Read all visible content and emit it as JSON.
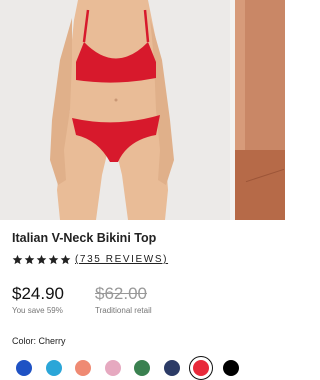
{
  "product": {
    "title": "Italian V-Neck Bikini Top",
    "rating_stars": 5,
    "reviews_text": "(735 REVIEWS)",
    "price": "$24.90",
    "savings": "You save 59%",
    "compare_price": "$62.00",
    "compare_label": "Traditional retail",
    "color_label": "Color: Cherry"
  },
  "swatches": [
    {
      "name": "blue",
      "color": "#1f52c4"
    },
    {
      "name": "turquoise",
      "color": "#2ba6d8"
    },
    {
      "name": "coral",
      "color": "#ef8a73"
    },
    {
      "name": "pink",
      "color": "#e6a9c0"
    },
    {
      "name": "green",
      "color": "#3a8150"
    },
    {
      "name": "navy",
      "color": "#2c3b66"
    },
    {
      "name": "cherry",
      "color": "#e8293a",
      "selected": true
    },
    {
      "name": "black",
      "color": "#000000"
    }
  ],
  "colors": {
    "bikini": "#d7192c",
    "skin": "#e9bc97",
    "background": "#eceae8"
  },
  "icons": [
    "star-icon"
  ]
}
